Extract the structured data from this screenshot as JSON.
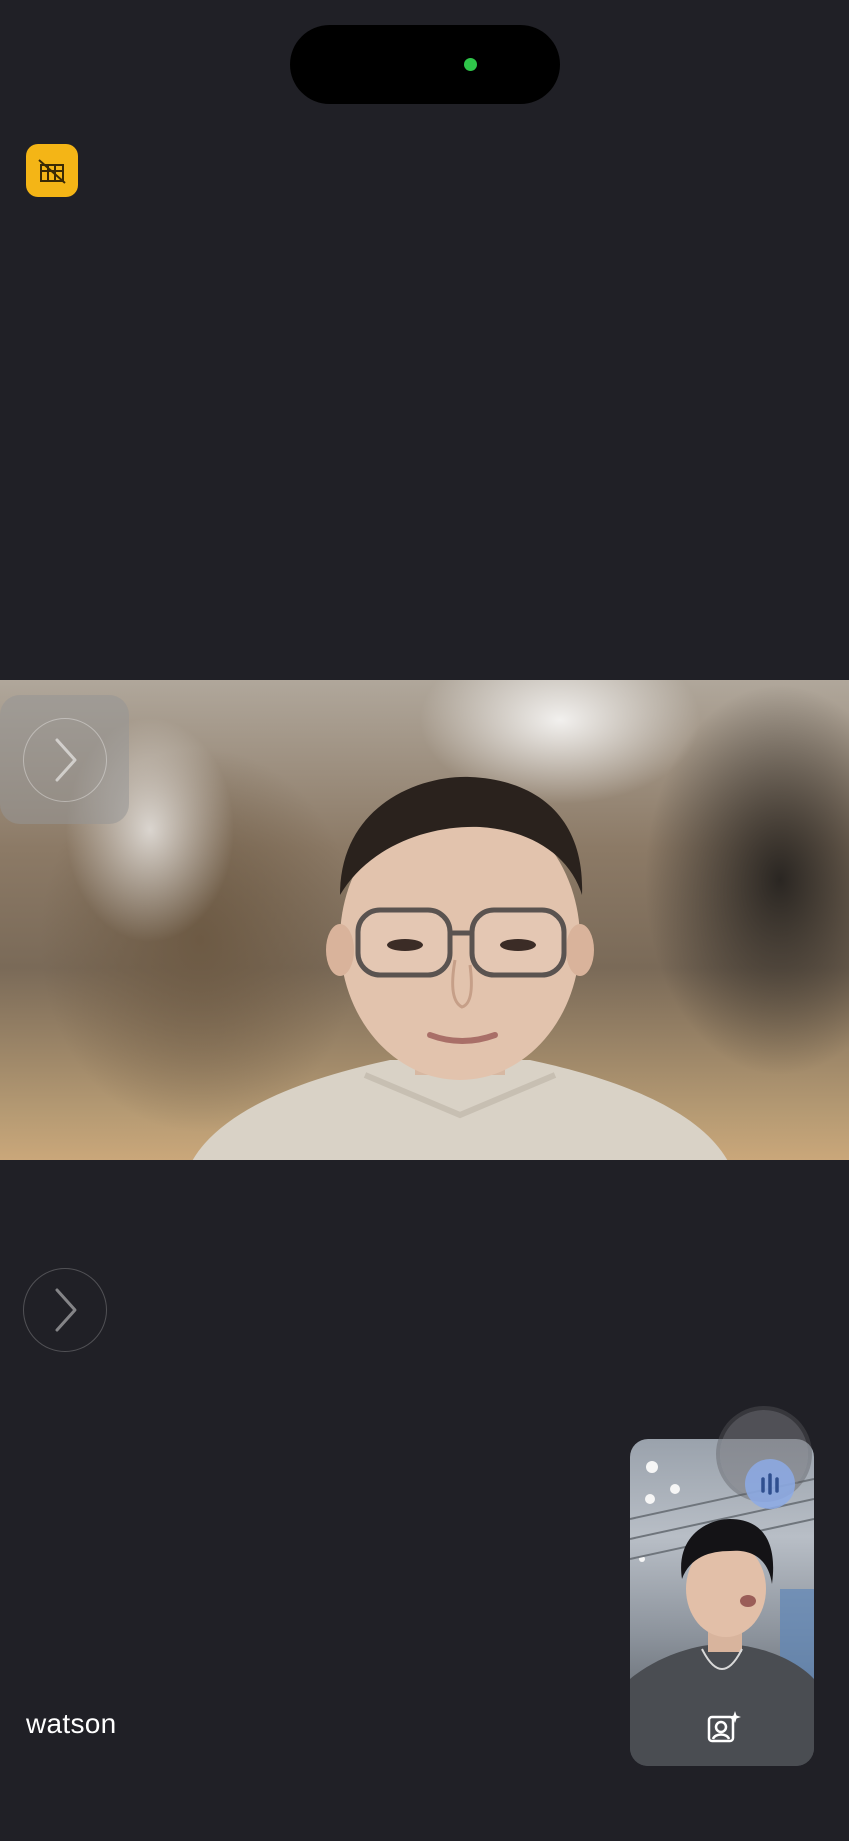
{
  "call": {
    "participant_name": "watson"
  },
  "status": {
    "camera_indicator": "on",
    "indicator_color": "#2fc54a"
  },
  "badge": {
    "icon": "video-off-filter-icon",
    "color": "#f4b516"
  },
  "controls": {
    "expand_icon": "chevron-right-icon",
    "audio_icon": "audio-waveform-icon",
    "portrait_icon": "portrait-mode-icon"
  }
}
